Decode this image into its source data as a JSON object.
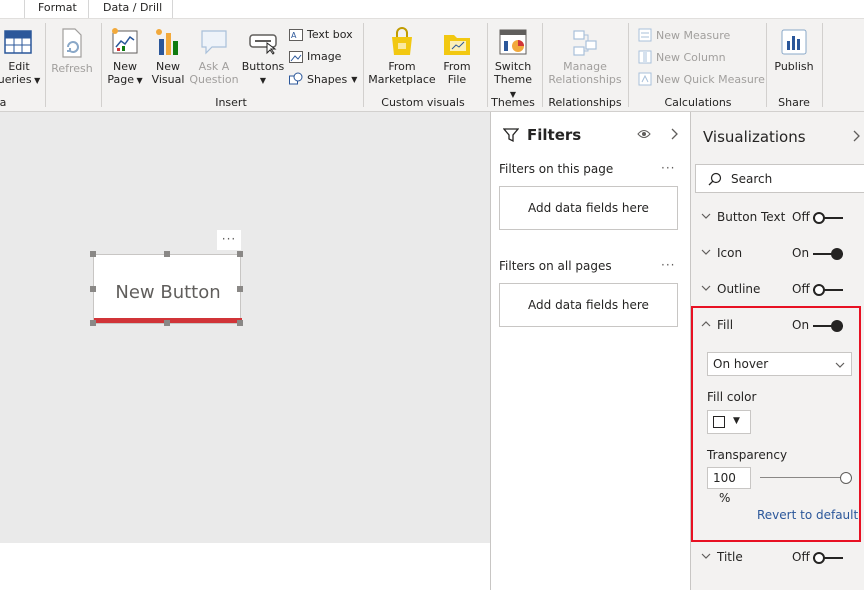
{
  "tabs": [
    "Format",
    "Data / Drill"
  ],
  "ribbon": {
    "edit_queries": [
      "Edit",
      "ueries"
    ],
    "refresh": "Refresh",
    "new_page": [
      "New",
      "Page"
    ],
    "new_visual": [
      "New",
      "Visual"
    ],
    "ask_question": [
      "Ask A",
      "Question"
    ],
    "buttons": "Buttons",
    "text_box": "Text box",
    "image": "Image",
    "shapes": "Shapes",
    "from_marketplace": [
      "From",
      "Marketplace"
    ],
    "from_file": [
      "From",
      "File"
    ],
    "switch_theme": [
      "Switch",
      "Theme"
    ],
    "manage_relationships": [
      "Manage",
      "Relationships"
    ],
    "new_measure": "New Measure",
    "new_column": "New Column",
    "new_quick_measure": "New Quick Measure",
    "publish": "Publish",
    "groups": {
      "data": "a",
      "insert": "Insert",
      "custom_visuals": "Custom visuals",
      "themes": "Themes",
      "relationships": "Relationships",
      "calculations": "Calculations",
      "share": "Share"
    }
  },
  "canvas": {
    "button_text": "New Button",
    "more": "···"
  },
  "filters": {
    "title": "Filters",
    "this_page": "Filters on this page",
    "all_pages": "Filters on all pages",
    "add_fields": "Add data fields here",
    "more": "···"
  },
  "viz": {
    "title": "Visualizations",
    "search": "Search",
    "cards": [
      {
        "label": "Button Text",
        "state": "Off"
      },
      {
        "label": "Icon",
        "state": "On"
      },
      {
        "label": "Outline",
        "state": "Off"
      },
      {
        "label": "Fill",
        "state": "On"
      },
      {
        "label": "Title",
        "state": "Off"
      }
    ],
    "fill_state": "On hover",
    "fill_color_label": "Fill color",
    "transparency_label": "Transparency",
    "transparency_value": "100",
    "transparency_unit": "%",
    "transparency_fraction": 1.0,
    "revert": "Revert to default"
  }
}
